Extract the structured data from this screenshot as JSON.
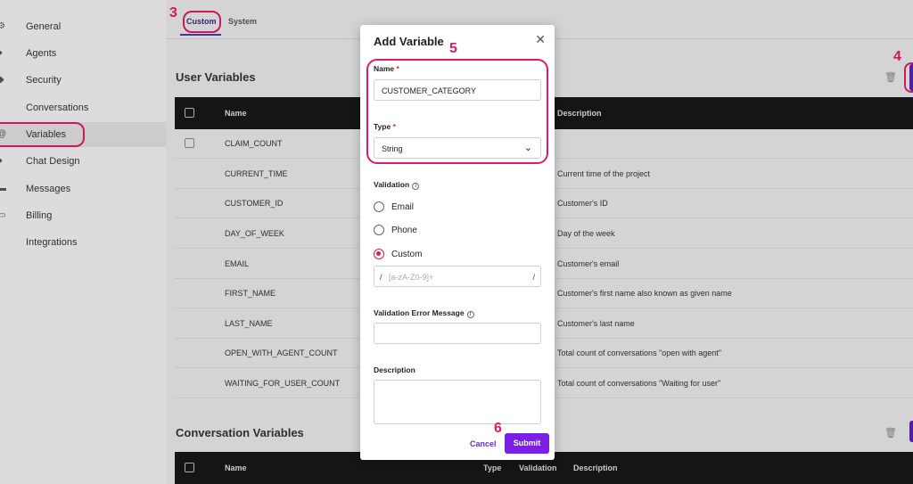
{
  "sidebar": {
    "items": [
      {
        "label": "General",
        "icon": "gear-icon"
      },
      {
        "label": "Agents",
        "icon": "users-icon"
      },
      {
        "label": "Security",
        "icon": "shield-icon"
      },
      {
        "label": "Conversations",
        "icon": "chat-icon"
      },
      {
        "label": "Variables",
        "icon": "at-icon"
      },
      {
        "label": "Chat Design",
        "icon": "palette-icon"
      },
      {
        "label": "Messages",
        "icon": "message-icon"
      },
      {
        "label": "Billing",
        "icon": "card-icon"
      },
      {
        "label": "Integrations",
        "icon": "integrations-icon"
      }
    ],
    "active": "Variables"
  },
  "tabs": [
    {
      "label": "Custom",
      "active": true
    },
    {
      "label": "System",
      "active": false
    }
  ],
  "user_variables": {
    "title": "User Variables",
    "columns": {
      "name": "Name",
      "description": "Description"
    },
    "rows": [
      {
        "name": "CLAIM_COUNT",
        "description": ""
      },
      {
        "name": "CURRENT_TIME",
        "description": "Current time of the project"
      },
      {
        "name": "CUSTOMER_ID",
        "description": "Customer's ID"
      },
      {
        "name": "DAY_OF_WEEK",
        "description": "Day of the week"
      },
      {
        "name": "EMAIL",
        "description": "Customer's email"
      },
      {
        "name": "FIRST_NAME",
        "description": "Customer's first name also known as given name"
      },
      {
        "name": "LAST_NAME",
        "description": "Customer's last name"
      },
      {
        "name": "OPEN_WITH_AGENT_COUNT",
        "description": "Total count of conversations \"open with agent\""
      },
      {
        "name": "WAITING_FOR_USER_COUNT",
        "description": "Total count of conversations \"Waiting for user\""
      }
    ]
  },
  "conversation_variables": {
    "title": "Conversation Variables",
    "columns": {
      "name": "Name",
      "type": "Type",
      "validation": "Validation",
      "description": "Description"
    }
  },
  "modal": {
    "title": "Add Variable",
    "close_icon": "close-icon",
    "name_label": "Name",
    "required_mark": "*",
    "name_value": "CUSTOMER_CATEGORY",
    "type_label": "Type",
    "type_value": "String",
    "validation_label": "Validation",
    "validation_options": [
      {
        "label": "Email",
        "checked": false
      },
      {
        "label": "Phone",
        "checked": false
      },
      {
        "label": "Custom",
        "checked": true
      }
    ],
    "regex_delimiter": "/",
    "regex_placeholder": "[a-zA-Z0-9]+",
    "error_message_label": "Validation Error Message",
    "description_label": "Description",
    "cancel_label": "Cancel",
    "submit_label": "Submit"
  },
  "annotations": [
    "3",
    "4",
    "5",
    "6"
  ],
  "colors": {
    "accent": "#7c1fe6",
    "annotation": "#e0196b",
    "table_header": "#171717"
  }
}
